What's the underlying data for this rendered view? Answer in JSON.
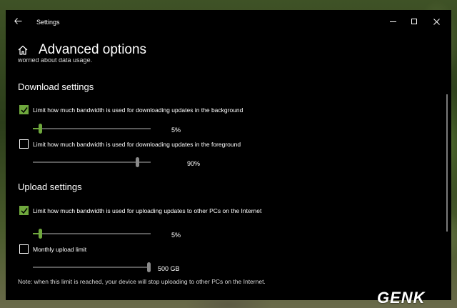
{
  "window": {
    "title": "Settings"
  },
  "page": {
    "title": "Advanced options",
    "clipped_text": "worried about data usage."
  },
  "download": {
    "heading": "Download settings",
    "background_limit": {
      "label": "Limit how much bandwidth is used for downloading updates in the background",
      "checked": true,
      "value": 5,
      "value_text": "5%"
    },
    "foreground_limit": {
      "label": "Limit how much bandwidth is used for downloading updates in the foreground",
      "checked": false,
      "value": 90,
      "value_text": "90%"
    }
  },
  "upload": {
    "heading": "Upload settings",
    "upload_limit": {
      "label": "Limit how much bandwidth is used for uploading updates to other PCs on the Internet",
      "checked": true,
      "value": 5,
      "value_text": "5%"
    },
    "monthly_limit": {
      "label": "Monthly upload limit",
      "checked": false,
      "value": 500,
      "value_text": "500 GB"
    },
    "note": "Note: when this limit is reached, your device will stop uploading to other PCs on the Internet."
  },
  "watermark": "GENK",
  "colors": {
    "accent": "#6fa83d",
    "background": "#000000",
    "track": "#5a5a5a"
  },
  "icons": [
    "back-arrow-icon",
    "home-icon",
    "minimize-icon",
    "maximize-icon",
    "close-icon",
    "checkmark-icon"
  ]
}
